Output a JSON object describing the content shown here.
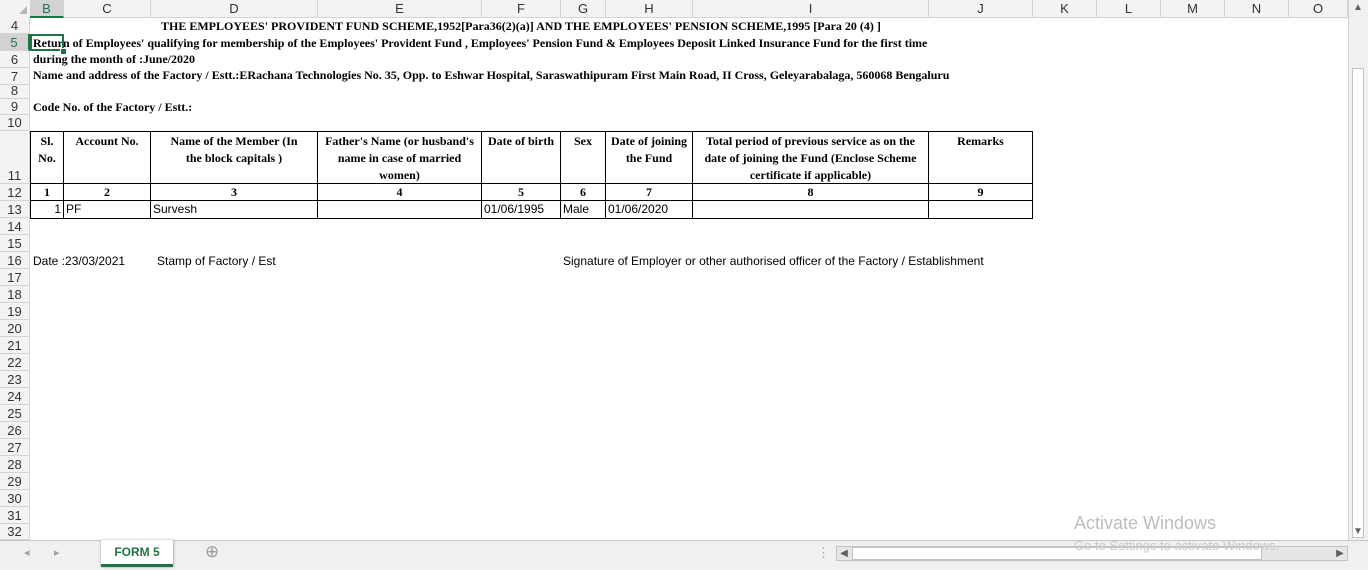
{
  "columns": [
    "B",
    "C",
    "D",
    "E",
    "F",
    "G",
    "H",
    "I",
    "J",
    "K",
    "L",
    "M",
    "N",
    "O"
  ],
  "rows": [
    "4",
    "5",
    "6",
    "7",
    "8",
    "9",
    "10",
    "11",
    "12",
    "13",
    "14",
    "15",
    "16",
    "17",
    "18",
    "19",
    "20",
    "21",
    "22",
    "23",
    "24",
    "25",
    "26",
    "27",
    "28",
    "29",
    "30",
    "31",
    "32"
  ],
  "sheet": {
    "title": "THE EMPLOYEES' PROVIDENT FUND SCHEME,1952[Para36(2)(a)] AND THE EMPLOYEES' PENSION SCHEME,1995  [Para 20 (4) ]",
    "line5": "Return of Employees' qualifying for membership of the Employees' Provident Fund , Employees' Pension Fund & Employees Deposit Linked Insurance Fund  for the first time",
    "line6": "during the month of :June/2020",
    "line7": "Name and address of the Factory / Estt.:ERachana Technologies No. 35, Opp. to Eshwar Hospital, Saraswathipuram First Main Road, II Cross, Geleyarabalaga, 560068 Bengaluru",
    "line9": "Code No. of the Factory / Estt.:"
  },
  "table": {
    "headers": {
      "sl_line1": "Sl.",
      "sl_line2": "No.",
      "account": "Account No.",
      "member_line1": "Name of the Member     (In",
      "member_line2": "the block capitals )",
      "father_line1": "Father's Name (or husband's",
      "father_line2": "name in case of married",
      "father_line3": "women)",
      "dob": "Date of birth",
      "sex": "Sex",
      "doj_line1": "Date of joining",
      "doj_line2": "the Fund",
      "prev_line1": "Total period of previous service as on the",
      "prev_line2": "date of joining the Fund (Enclose Scheme",
      "prev_line3": "certificate if applicable)",
      "remarks": "Remarks"
    },
    "numbers": [
      "1",
      "2",
      "3",
      "4",
      "5",
      "6",
      "7",
      "8",
      "9"
    ],
    "row": {
      "sl": "1",
      "account": "PF",
      "member": "Survesh",
      "father": "",
      "dob": "01/06/1995",
      "sex": "Male",
      "doj": "01/06/2020",
      "prev": "",
      "remarks": ""
    }
  },
  "footer": {
    "date": "Date :23/03/2021",
    "stamp": "Stamp of Factory / Est",
    "signature": "Signature of Employer or other authorised officer of the Factory  / Establishment"
  },
  "tabs": {
    "sheet_tab": "FORM 5",
    "add_sheet": "⊕",
    "prev": "◂",
    "next": "▸"
  },
  "watermark": {
    "line1": "Activate Windows",
    "line2": "Go to Settings to activate Windows."
  },
  "colors": {
    "accent": "#217346",
    "grid": "#d4d4d4"
  }
}
